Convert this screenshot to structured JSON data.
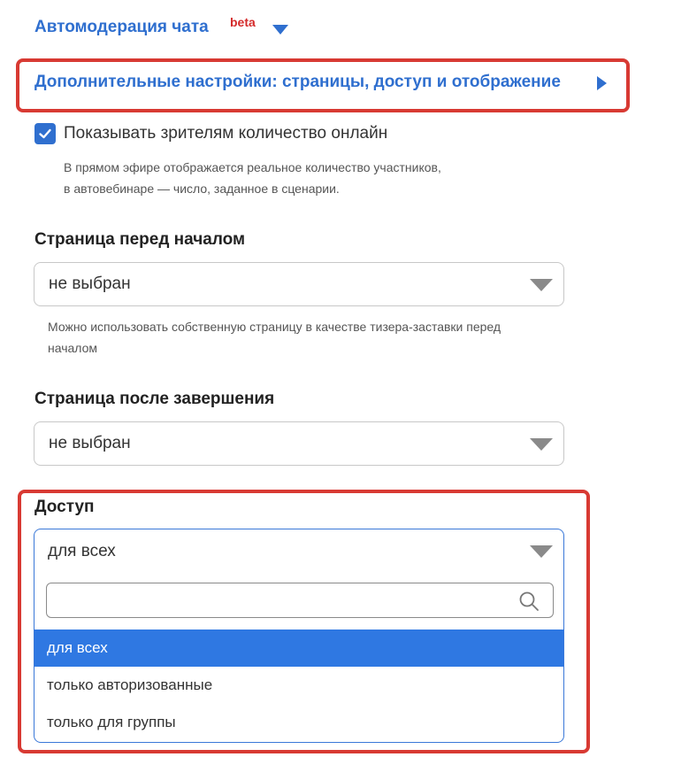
{
  "header": {
    "automoderation_label": "Автомодерация чата",
    "beta_badge": "beta",
    "advanced_settings_label": "Дополнительные настройки: страницы, доступ и отображение"
  },
  "online_count": {
    "checkbox_label": "Показывать зрителям количество онлайн",
    "checked": true,
    "hint_line1": "В прямом эфире отображается реальное количество участников,",
    "hint_line2": "в автовебинаре — число, заданное в сценарии."
  },
  "page_before": {
    "heading": "Страница перед началом",
    "value": "не выбран",
    "hint_line1": "Можно использовать собственную страницу в качестве тизера-заставки перед",
    "hint_line2": "началом"
  },
  "page_after": {
    "heading": "Страница после завершения",
    "value": "не выбран"
  },
  "access": {
    "heading": "Доступ",
    "value": "для всех",
    "search_placeholder": "",
    "options": [
      {
        "label": "для всех",
        "selected": true
      },
      {
        "label": "только авторизованные",
        "selected": false
      },
      {
        "label": "только для группы",
        "selected": false
      }
    ]
  },
  "colors": {
    "accent": "#2f6fcf",
    "highlight_border": "#d83a33",
    "selected_option_bg": "#2f78e2",
    "beta": "#d42a2a"
  }
}
